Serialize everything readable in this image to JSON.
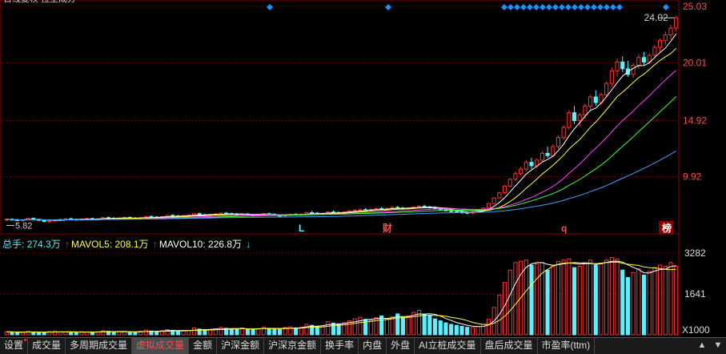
{
  "header": {
    "title_fragment": "日线复权  拉全成分"
  },
  "price_axis": {
    "ticks": [
      "25.03",
      "20.01",
      "14.92",
      "9.92"
    ],
    "tick_values": [
      25.03,
      20.01,
      14.92,
      9.92
    ]
  },
  "price_marks": {
    "high_label": "24.02",
    "low_label": "5.82",
    "high_value": 24.02,
    "low_value": 5.82
  },
  "event_markers": [
    {
      "text": "L",
      "color": "#5cf0ff"
    },
    {
      "text": "财",
      "color": "#ff4d4d"
    },
    {
      "text": "q",
      "color": "#ff4d4d"
    },
    {
      "text": "榜",
      "color": "#ffffff"
    }
  ],
  "volume_legend": {
    "total_label": "总手: 274.3万",
    "ma5_label": "MAVOL5: 208.1万",
    "ma10_label": "MAVOL10: 226.8万",
    "ma5_arrow": "↑",
    "ma10_arrow": "↑",
    "trend_arrow": "↓"
  },
  "volume_axis": {
    "ticks": [
      "3282",
      "1641"
    ],
    "tick_values": [
      3282,
      1641
    ],
    "unit_label": "X1000"
  },
  "toolbar": {
    "tabs": [
      {
        "label": "设置"
      },
      {
        "label": "成交量"
      },
      {
        "label": "多周期成交量"
      },
      {
        "label": "虚拟成交量",
        "active": true
      },
      {
        "label": "金额"
      },
      {
        "label": "沪深金额"
      },
      {
        "label": "沪深京金额"
      },
      {
        "label": "换手率"
      },
      {
        "label": "内盘"
      },
      {
        "label": "外盘"
      },
      {
        "label": "AI立桩成交量"
      },
      {
        "label": "盘后成交量"
      },
      {
        "label": "市盈率(ttm)"
      }
    ],
    "menu_icons": [
      "up-icon",
      "down-icon"
    ]
  },
  "colors": {
    "up": "#ff3333",
    "down": "#5cf0ff",
    "ma5": "#ffffff",
    "ma10": "#ffff40",
    "ma20": "#ff40ff",
    "ma30": "#40ff40",
    "ma60": "#40a0ff",
    "grid": "#8b0000"
  },
  "chart_data": {
    "type": "candlestick",
    "price_range": [
      5.0,
      25.03
    ],
    "volume_range": [
      0,
      3282
    ],
    "candles": [
      [
        6.1,
        6.2,
        6.0,
        6.15
      ],
      [
        6.15,
        6.25,
        6.05,
        6.1
      ],
      [
        6.1,
        6.2,
        6.0,
        6.05
      ],
      [
        6.05,
        6.15,
        5.95,
        6.1
      ],
      [
        6.1,
        6.3,
        6.05,
        6.25
      ],
      [
        6.25,
        6.3,
        6.1,
        6.15
      ],
      [
        6.15,
        6.2,
        6.0,
        6.05
      ],
      [
        6.05,
        6.1,
        5.9,
        5.95
      ],
      [
        5.95,
        6.05,
        5.82,
        6.0
      ],
      [
        6.0,
        6.15,
        5.95,
        6.1
      ],
      [
        6.1,
        6.2,
        6.0,
        6.15
      ],
      [
        6.15,
        6.25,
        6.05,
        6.2
      ],
      [
        6.2,
        6.3,
        6.1,
        6.15
      ],
      [
        6.15,
        6.2,
        6.05,
        6.1
      ],
      [
        6.1,
        6.2,
        6.0,
        6.18
      ],
      [
        6.18,
        6.28,
        6.1,
        6.22
      ],
      [
        6.22,
        6.3,
        6.12,
        6.15
      ],
      [
        6.15,
        6.25,
        6.08,
        6.2
      ],
      [
        6.2,
        6.35,
        6.15,
        6.3
      ],
      [
        6.3,
        6.4,
        6.2,
        6.25
      ],
      [
        6.25,
        6.35,
        6.15,
        6.2
      ],
      [
        6.2,
        6.3,
        6.1,
        6.28
      ],
      [
        6.28,
        6.38,
        6.2,
        6.32
      ],
      [
        6.32,
        6.4,
        6.2,
        6.25
      ],
      [
        6.25,
        6.35,
        6.15,
        6.22
      ],
      [
        6.22,
        6.32,
        6.12,
        6.3
      ],
      [
        6.3,
        6.45,
        6.25,
        6.4
      ],
      [
        6.4,
        6.5,
        6.3,
        6.35
      ],
      [
        6.35,
        6.45,
        6.25,
        6.3
      ],
      [
        6.3,
        6.4,
        6.2,
        6.38
      ],
      [
        6.38,
        6.55,
        6.3,
        6.5
      ],
      [
        6.5,
        6.6,
        6.4,
        6.45
      ],
      [
        6.45,
        6.55,
        6.35,
        6.4
      ],
      [
        6.4,
        6.5,
        6.3,
        6.48
      ],
      [
        6.48,
        6.58,
        6.4,
        6.52
      ],
      [
        6.52,
        6.7,
        6.45,
        6.65
      ],
      [
        6.65,
        6.75,
        6.5,
        6.55
      ],
      [
        6.55,
        6.65,
        6.45,
        6.5
      ],
      [
        6.5,
        6.6,
        6.4,
        6.58
      ],
      [
        6.58,
        6.7,
        6.5,
        6.62
      ],
      [
        6.62,
        6.75,
        6.55,
        6.7
      ],
      [
        6.7,
        6.8,
        6.6,
        6.65
      ],
      [
        6.65,
        6.75,
        6.55,
        6.6
      ],
      [
        6.6,
        6.7,
        6.5,
        6.55
      ],
      [
        6.55,
        6.65,
        6.45,
        6.62
      ],
      [
        6.62,
        6.7,
        6.5,
        6.55
      ],
      [
        6.55,
        6.65,
        6.45,
        6.5
      ],
      [
        6.5,
        6.6,
        6.4,
        6.58
      ],
      [
        6.58,
        6.7,
        6.5,
        6.65
      ],
      [
        6.65,
        6.75,
        6.55,
        6.6
      ],
      [
        6.6,
        6.7,
        6.45,
        6.5
      ],
      [
        6.5,
        6.6,
        6.4,
        6.45
      ],
      [
        6.45,
        6.55,
        6.35,
        6.52
      ],
      [
        6.52,
        6.65,
        6.45,
        6.6
      ],
      [
        6.6,
        6.7,
        6.5,
        6.55
      ],
      [
        6.55,
        6.65,
        6.45,
        6.62
      ],
      [
        6.62,
        6.8,
        6.55,
        6.75
      ],
      [
        6.75,
        6.9,
        6.65,
        6.7
      ],
      [
        6.7,
        6.8,
        6.55,
        6.6
      ],
      [
        6.6,
        6.7,
        6.5,
        6.68
      ],
      [
        6.68,
        6.85,
        6.6,
        6.8
      ],
      [
        6.8,
        6.95,
        6.7,
        6.75
      ],
      [
        6.75,
        6.85,
        6.65,
        6.72
      ],
      [
        6.72,
        6.85,
        6.6,
        6.8
      ],
      [
        6.8,
        6.95,
        6.7,
        6.9
      ],
      [
        6.9,
        7.05,
        6.8,
        6.95
      ],
      [
        6.95,
        7.1,
        6.85,
        7.0
      ],
      [
        7.0,
        7.15,
        6.9,
        6.95
      ],
      [
        6.95,
        7.05,
        6.85,
        7.02
      ],
      [
        7.02,
        7.2,
        6.95,
        7.1
      ],
      [
        7.1,
        7.25,
        7.0,
        7.05
      ],
      [
        7.05,
        7.15,
        6.95,
        7.12
      ],
      [
        7.12,
        7.3,
        7.05,
        7.2
      ],
      [
        7.2,
        7.35,
        7.1,
        7.15
      ],
      [
        7.15,
        7.25,
        7.0,
        7.08
      ],
      [
        7.08,
        7.2,
        7.0,
        7.15
      ],
      [
        7.15,
        7.3,
        7.05,
        7.25
      ],
      [
        7.25,
        7.4,
        7.15,
        7.3
      ],
      [
        7.3,
        7.45,
        7.2,
        7.25
      ],
      [
        7.25,
        7.35,
        7.1,
        7.18
      ],
      [
        7.18,
        7.3,
        7.05,
        7.1
      ],
      [
        7.1,
        7.2,
        6.95,
        7.0
      ],
      [
        7.0,
        7.1,
        6.85,
        6.9
      ],
      [
        6.9,
        7.0,
        6.75,
        6.85
      ],
      [
        6.85,
        6.95,
        6.7,
        6.8
      ],
      [
        6.8,
        6.9,
        6.65,
        6.75
      ],
      [
        6.75,
        6.85,
        6.6,
        6.7
      ],
      [
        6.7,
        6.85,
        6.6,
        6.8
      ],
      [
        6.8,
        7.0,
        6.75,
        6.95
      ],
      [
        6.95,
        7.2,
        6.9,
        7.15
      ],
      [
        7.15,
        7.6,
        7.1,
        7.55
      ],
      [
        7.55,
        8.1,
        7.5,
        8.05
      ],
      [
        8.05,
        8.6,
        7.95,
        8.5
      ],
      [
        8.5,
        9.2,
        8.4,
        9.1
      ],
      [
        9.1,
        9.8,
        9.0,
        9.7
      ],
      [
        9.7,
        10.4,
        9.5,
        10.2
      ],
      [
        10.2,
        10.8,
        10.0,
        10.6
      ],
      [
        10.6,
        11.4,
        10.4,
        11.2
      ],
      [
        11.2,
        11.6,
        10.6,
        10.9
      ],
      [
        10.9,
        11.5,
        10.7,
        11.4
      ],
      [
        11.4,
        12.2,
        11.2,
        12.0
      ],
      [
        12.0,
        12.6,
        11.6,
        11.8
      ],
      [
        11.8,
        12.8,
        11.7,
        12.6
      ],
      [
        12.6,
        13.6,
        12.4,
        13.4
      ],
      [
        13.4,
        14.5,
        13.2,
        14.3
      ],
      [
        14.3,
        15.8,
        14.1,
        15.6
      ],
      [
        15.6,
        16.2,
        14.6,
        14.9
      ],
      [
        14.9,
        15.6,
        14.4,
        15.4
      ],
      [
        15.4,
        16.4,
        15.1,
        16.2
      ],
      [
        16.2,
        17.2,
        15.9,
        17.0
      ],
      [
        17.0,
        17.6,
        16.2,
        16.5
      ],
      [
        16.5,
        17.4,
        16.3,
        17.2
      ],
      [
        17.2,
        18.4,
        17.0,
        18.2
      ],
      [
        18.2,
        19.6,
        17.9,
        19.3
      ],
      [
        19.3,
        20.4,
        18.8,
        20.1
      ],
      [
        20.1,
        20.6,
        19.2,
        19.5
      ],
      [
        19.5,
        20.2,
        18.8,
        19.0
      ],
      [
        19.0,
        20.0,
        18.7,
        19.8
      ],
      [
        19.8,
        20.8,
        19.5,
        20.5
      ],
      [
        20.5,
        21.0,
        19.8,
        20.1
      ],
      [
        20.1,
        20.9,
        19.9,
        20.7
      ],
      [
        20.7,
        21.6,
        20.4,
        21.4
      ],
      [
        21.4,
        22.2,
        21.0,
        22.0
      ],
      [
        22.0,
        22.8,
        21.6,
        22.5
      ],
      [
        22.5,
        23.4,
        22.1,
        23.1
      ],
      [
        23.1,
        24.2,
        22.8,
        24.02
      ]
    ],
    "volumes": [
      120,
      110,
      95,
      100,
      140,
      105,
      90,
      85,
      130,
      150,
      120,
      110,
      100,
      95,
      125,
      110,
      100,
      115,
      160,
      140,
      120,
      130,
      115,
      105,
      100,
      140,
      190,
      150,
      130,
      160,
      210,
      180,
      150,
      170,
      160,
      280,
      230,
      190,
      210,
      240,
      300,
      260,
      230,
      220,
      270,
      230,
      210,
      250,
      310,
      260,
      240,
      210,
      290,
      320,
      280,
      300,
      420,
      380,
      340,
      360,
      520,
      470,
      440,
      480,
      560,
      640,
      700,
      620,
      580,
      690,
      760,
      640,
      720,
      840,
      700,
      760,
      900,
      980,
      820,
      760,
      640,
      560,
      480,
      420,
      380,
      340,
      300,
      290,
      330,
      420,
      620,
      1100,
      1600,
      2100,
      2600,
      2900,
      2950,
      3000,
      2800,
      2850,
      2900,
      2600,
      2800,
      2950,
      3000,
      3050,
      2700,
      2750,
      2900,
      3000,
      2800,
      2850,
      3000,
      3100,
      3050,
      2600,
      2300,
      2500,
      2650,
      2400,
      2550,
      2700,
      2800,
      2750,
      2900,
      2743
    ],
    "ma_series": [
      "MA5",
      "MA10",
      "MA20",
      "MA30",
      "MA60"
    ],
    "volume_ma": [
      "MAVOL5",
      "MAVOL10"
    ]
  }
}
